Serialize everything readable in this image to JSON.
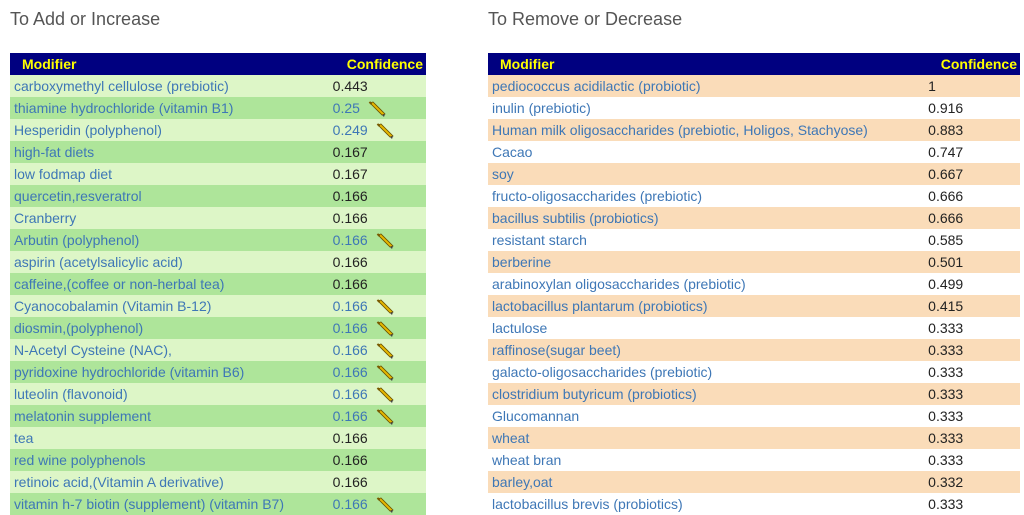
{
  "left": {
    "heading": "To Add or Increase",
    "columns": [
      "Modifier",
      "Confidence"
    ],
    "rows": [
      {
        "modifier": "carboxymethyl cellulose (prebiotic)",
        "confidence": "0.443",
        "edit": false
      },
      {
        "modifier": "thiamine hydrochloride (vitamin B1)",
        "confidence": "0.25",
        "edit": true
      },
      {
        "modifier": "Hesperidin (polyphenol)",
        "confidence": "0.249",
        "edit": true
      },
      {
        "modifier": "high-fat diets",
        "confidence": "0.167",
        "edit": false
      },
      {
        "modifier": "low fodmap diet",
        "confidence": "0.167",
        "edit": false
      },
      {
        "modifier": "quercetin,resveratrol",
        "confidence": "0.166",
        "edit": false
      },
      {
        "modifier": "Cranberry",
        "confidence": "0.166",
        "edit": false
      },
      {
        "modifier": "Arbutin (polyphenol)",
        "confidence": "0.166",
        "edit": true
      },
      {
        "modifier": "aspirin (acetylsalicylic acid)",
        "confidence": "0.166",
        "edit": false
      },
      {
        "modifier": "caffeine,(coffee or non-herbal tea)",
        "confidence": "0.166",
        "edit": false
      },
      {
        "modifier": "Cyanocobalamin (Vitamin B-12)",
        "confidence": "0.166",
        "edit": true
      },
      {
        "modifier": "diosmin,(polyphenol)",
        "confidence": "0.166",
        "edit": true
      },
      {
        "modifier": "N-Acetyl Cysteine (NAC),",
        "confidence": "0.166",
        "edit": true
      },
      {
        "modifier": "pyridoxine hydrochloride (vitamin B6)",
        "confidence": "0.166",
        "edit": true
      },
      {
        "modifier": "luteolin (flavonoid)",
        "confidence": "0.166",
        "edit": true
      },
      {
        "modifier": "melatonin supplement",
        "confidence": "0.166",
        "edit": true
      },
      {
        "modifier": "tea",
        "confidence": "0.166",
        "edit": false
      },
      {
        "modifier": "red wine polyphenols",
        "confidence": "0.166",
        "edit": false
      },
      {
        "modifier": "retinoic acid,(Vitamin A derivative)",
        "confidence": "0.166",
        "edit": false
      },
      {
        "modifier": "vitamin h-7 biotin (supplement) (vitamin B7)",
        "confidence": "0.166",
        "edit": true
      }
    ]
  },
  "right": {
    "heading": "To Remove or Decrease",
    "columns": [
      "Modifier",
      "Confidence"
    ],
    "rows": [
      {
        "modifier": "pediococcus acidilactic (probiotic)",
        "confidence": "1"
      },
      {
        "modifier": "inulin (prebiotic)",
        "confidence": "0.916"
      },
      {
        "modifier": "Human milk oligosaccharides (prebiotic, Holigos, Stachyose)",
        "confidence": "0.883"
      },
      {
        "modifier": "Cacao",
        "confidence": "0.747"
      },
      {
        "modifier": "soy",
        "confidence": "0.667"
      },
      {
        "modifier": "fructo-oligosaccharides (prebiotic)",
        "confidence": "0.666"
      },
      {
        "modifier": "bacillus subtilis (probiotics)",
        "confidence": "0.666"
      },
      {
        "modifier": "resistant starch",
        "confidence": "0.585"
      },
      {
        "modifier": "berberine",
        "confidence": "0.501"
      },
      {
        "modifier": "arabinoxylan oligosaccharides (prebiotic)",
        "confidence": "0.499"
      },
      {
        "modifier": "lactobacillus plantarum (probiotics)",
        "confidence": "0.415"
      },
      {
        "modifier": "lactulose",
        "confidence": "0.333"
      },
      {
        "modifier": "raffinose(sugar beet)",
        "confidence": "0.333"
      },
      {
        "modifier": "galacto-oligosaccharides (prebiotic)",
        "confidence": "0.333"
      },
      {
        "modifier": "clostridium butyricum (probiotics)",
        "confidence": "0.333"
      },
      {
        "modifier": "Glucomannan",
        "confidence": "0.333"
      },
      {
        "modifier": "wheat",
        "confidence": "0.333"
      },
      {
        "modifier": "wheat bran",
        "confidence": "0.333"
      },
      {
        "modifier": "barley,oat",
        "confidence": "0.332"
      },
      {
        "modifier": "lactobacillus brevis (probiotics)",
        "confidence": "0.333"
      }
    ]
  },
  "colors": {
    "header_bg": "#000080",
    "header_text": "#ffff00",
    "link": "#3e77b6",
    "left_row_light": "#ddf6c7",
    "left_row_dark": "#aee59a",
    "right_row_tan": "#fadcb9"
  },
  "icons": {
    "edit": "pencil-icon"
  }
}
